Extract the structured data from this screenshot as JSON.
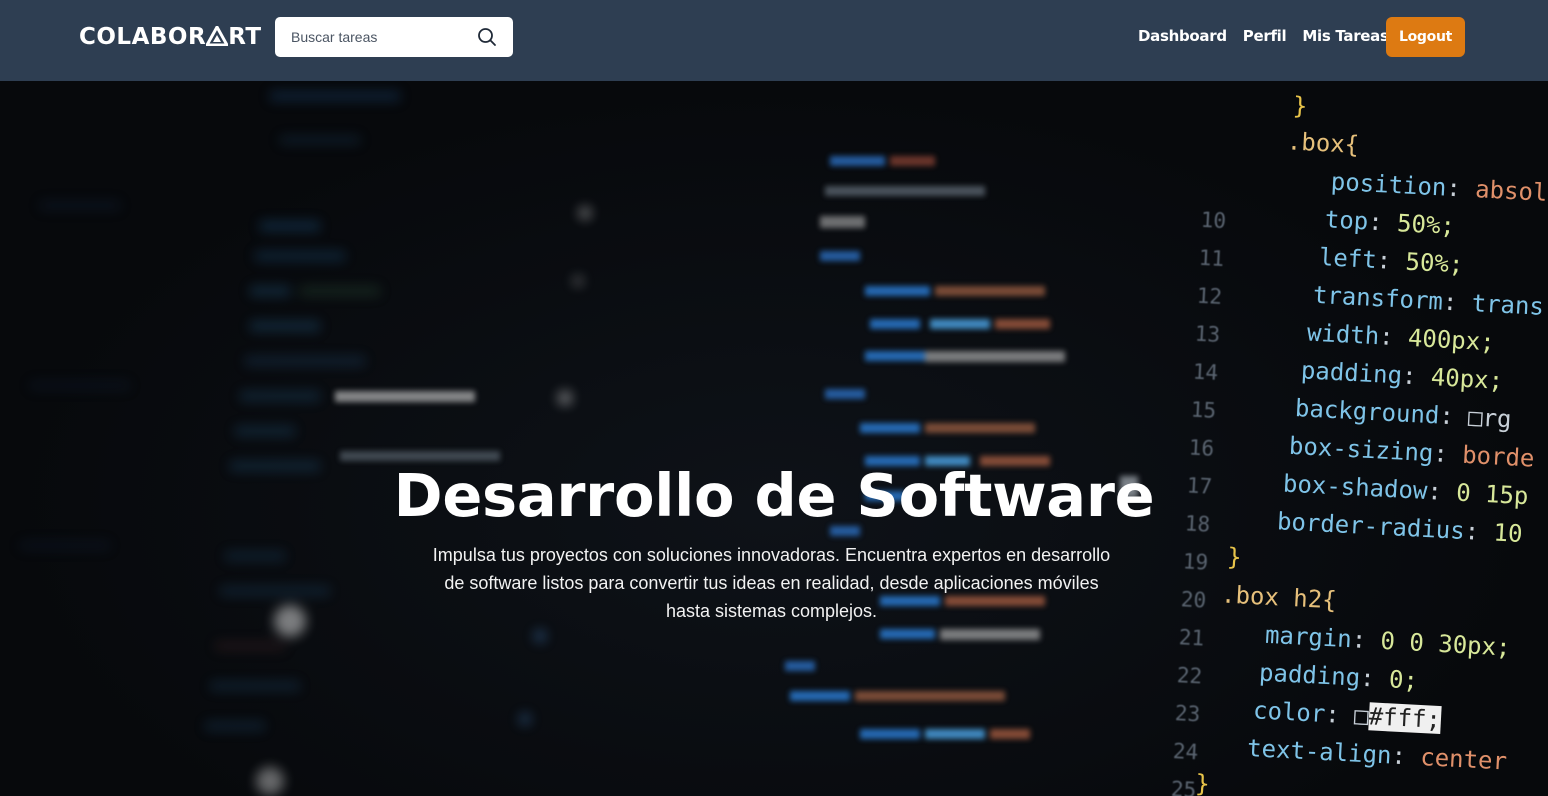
{
  "navbar": {
    "logo": {
      "prefix": "COLABOR",
      "suffix": "RT"
    },
    "search": {
      "placeholder": "Buscar tareas"
    },
    "links": [
      {
        "label": "Dashboard"
      },
      {
        "label": "Perfil"
      },
      {
        "label": "Mis Tareas"
      }
    ],
    "logout_label": "Logout",
    "colors": {
      "bar": "#2e3e52",
      "logout": "#dd7a12"
    }
  },
  "hero": {
    "title": "Desarrollo de Software",
    "description": "Impulsa tus proyectos con soluciones innovadoras. Encuentra expertos en desarrollo de software listos para convertir tus ideas en realidad, desde aplicaciones móviles hasta sistemas complejos.",
    "background": {
      "line_numbers": [
        "10",
        "11",
        "12",
        "13",
        "14",
        "15",
        "16",
        "17",
        "18",
        "19",
        "20",
        "21",
        "22",
        "23",
        "24",
        "25"
      ],
      "code": [
        {
          "text": "}"
        },
        {
          "text": ".box{"
        },
        {
          "prop": "position",
          "value": "absol"
        },
        {
          "prop": "top",
          "value": "50%;"
        },
        {
          "prop": "left",
          "value": "50%;"
        },
        {
          "prop": "transform",
          "value": "trans"
        },
        {
          "prop": "width",
          "value": "400px;"
        },
        {
          "prop": "padding",
          "value": "40px;"
        },
        {
          "prop": "background",
          "value": "rg"
        },
        {
          "prop": "box-sizing",
          "value": "borde"
        },
        {
          "prop": "box-shadow",
          "value": "0 15p"
        },
        {
          "prop": "border-radius",
          "value": "10"
        },
        {
          "text": "}"
        },
        {
          "text": ".box h2{"
        },
        {
          "prop": "margin",
          "value": "0 0 30px;"
        },
        {
          "prop": "padding",
          "value": "0;"
        },
        {
          "prop": "color",
          "value": "#fff;"
        },
        {
          "prop": "text-align",
          "value": "center"
        },
        {
          "text": "}"
        }
      ],
      "blurred_snippets": [
        "inputBox",
        "text",
        "Nombre de Us",
        "inputBox",
        "passwo",
        "Correo E",
        "inputBox"
      ]
    }
  }
}
